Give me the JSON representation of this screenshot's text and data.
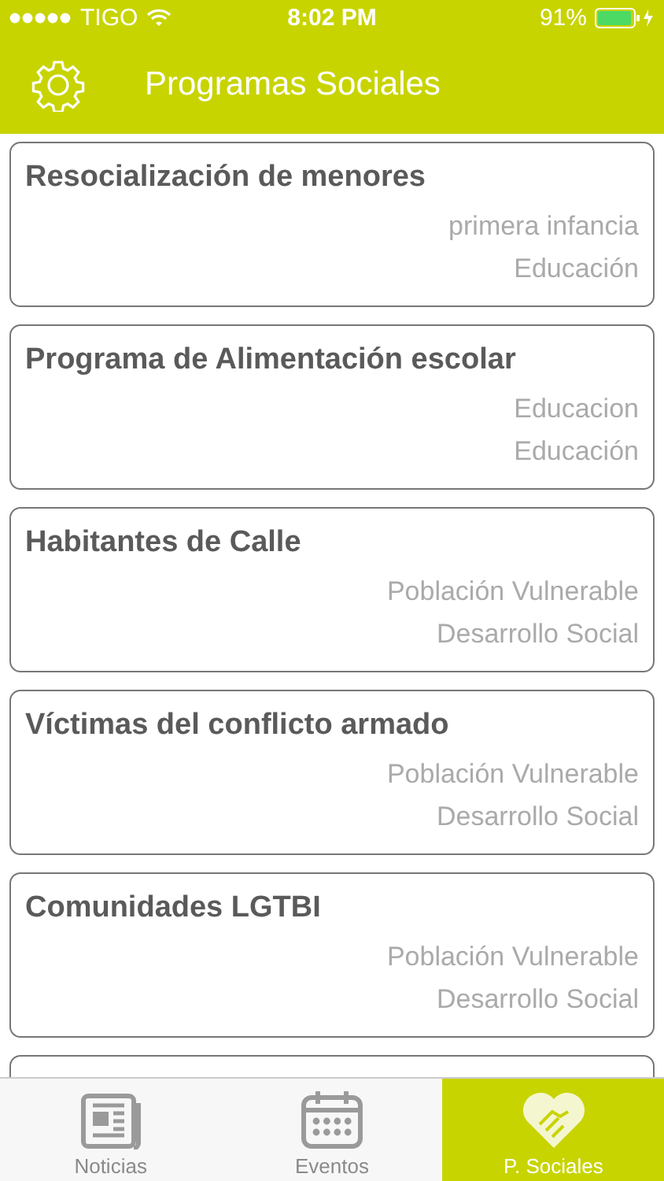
{
  "status_bar": {
    "carrier": "TIGO",
    "time": "8:02 PM",
    "battery": "91%"
  },
  "header": {
    "title": "Programas Sociales"
  },
  "programs": [
    {
      "title": "Resocialización de menores",
      "lines": [
        "primera infancia",
        "Educación"
      ]
    },
    {
      "title": "Programa de Alimentación escolar",
      "lines": [
        "Educacion",
        "Educación"
      ]
    },
    {
      "title": "Habitantes de Calle",
      "lines": [
        "Población Vulnerable",
        "Desarrollo Social"
      ]
    },
    {
      "title": "Víctimas del conflicto armado",
      "lines": [
        "Población Vulnerable",
        "Desarrollo Social"
      ]
    },
    {
      "title": "Comunidades LGTBI",
      "lines": [
        "Población Vulnerable",
        "Desarrollo Social"
      ]
    }
  ],
  "tabs": [
    {
      "kind": "news",
      "label": "Noticias",
      "selected": false
    },
    {
      "kind": "calendar",
      "label": "Eventos",
      "selected": false
    },
    {
      "kind": "heart",
      "label": "P. Sociales",
      "selected": true
    }
  ]
}
